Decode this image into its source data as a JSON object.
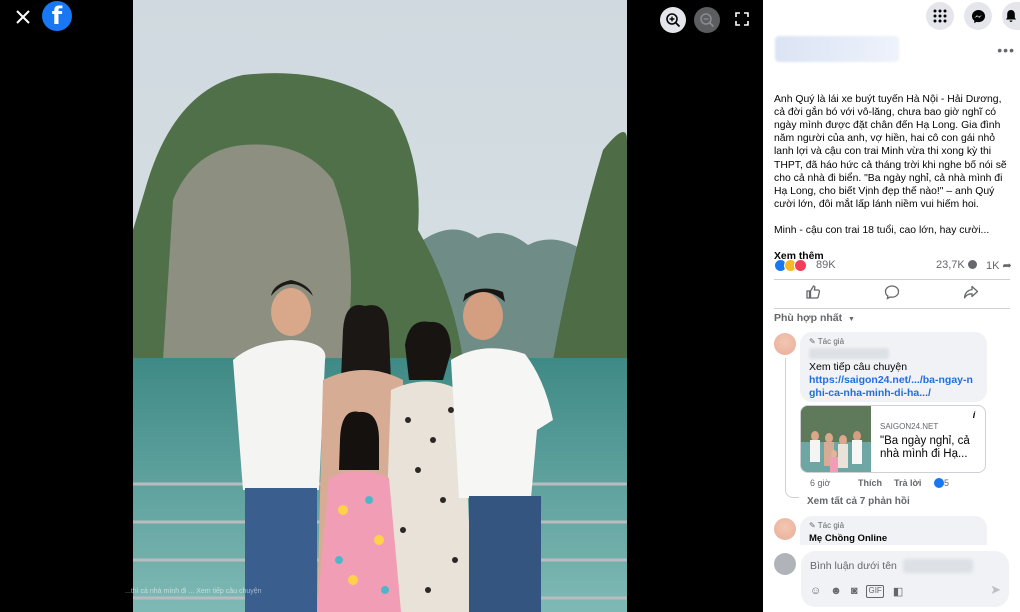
{
  "viewer": {
    "close_icon": "close-icon",
    "logo": "f",
    "watermark": "...thì cả nhà mình đi ... Xem tiếp câu chuyện"
  },
  "post": {
    "text": "Anh Quý là lái xe buýt tuyến Hà Nội - Hải Dương, cả đời gắn bó với vô-lăng, chưa bao giờ nghĩ có ngày mình được đặt chân đến Hạ Long. Gia đình năm người của anh, vợ hiền, hai cô con gái nhỏ lanh lợi và cậu con trai Minh vừa thi xong kỳ thi THPT, đã háo hức cả tháng trời khi nghe bố nói sẽ cho cả nhà đi biển. \"Ba ngày nghỉ, cả nhà mình đi Hạ Long, cho biết Vịnh đẹp thế nào!\" – anh Quý cười lớn, đôi mắt lấp lánh niềm vui hiếm hoi.\n\nMinh - cậu con trai 18 tuổi, cao lớn, hay cười...",
    "see_more": "Xem thêm",
    "reactions_count": "89K",
    "comments_count": "23,7K",
    "shares_count": "1K",
    "colors": {
      "like": "#1877f2",
      "haha": "#f7b928",
      "love": "#f33e58"
    }
  },
  "comments": {
    "sort_label": "Phù hợp nhất",
    "c1": {
      "tag": "Tác giả",
      "text": "Xem tiếp câu chuyện",
      "link": "https://saigon24.net/.../ba-ngay-nghi-ca-nha-minh-di-ha.../",
      "card_source": "SAIGON24.NET",
      "card_title": "\"Ba ngày nghỉ, cả nhà mình đi Hạ...",
      "time": "6 giờ",
      "like": "Thích",
      "reply": "Trả lời",
      "likes": "645"
    },
    "view_replies": "Xem tất cả 7 phản hồi",
    "c2": {
      "tag": "Tác giả",
      "name": "Mẹ Chồng Online"
    },
    "input_placeholder": "Bình luận dưới tên"
  }
}
